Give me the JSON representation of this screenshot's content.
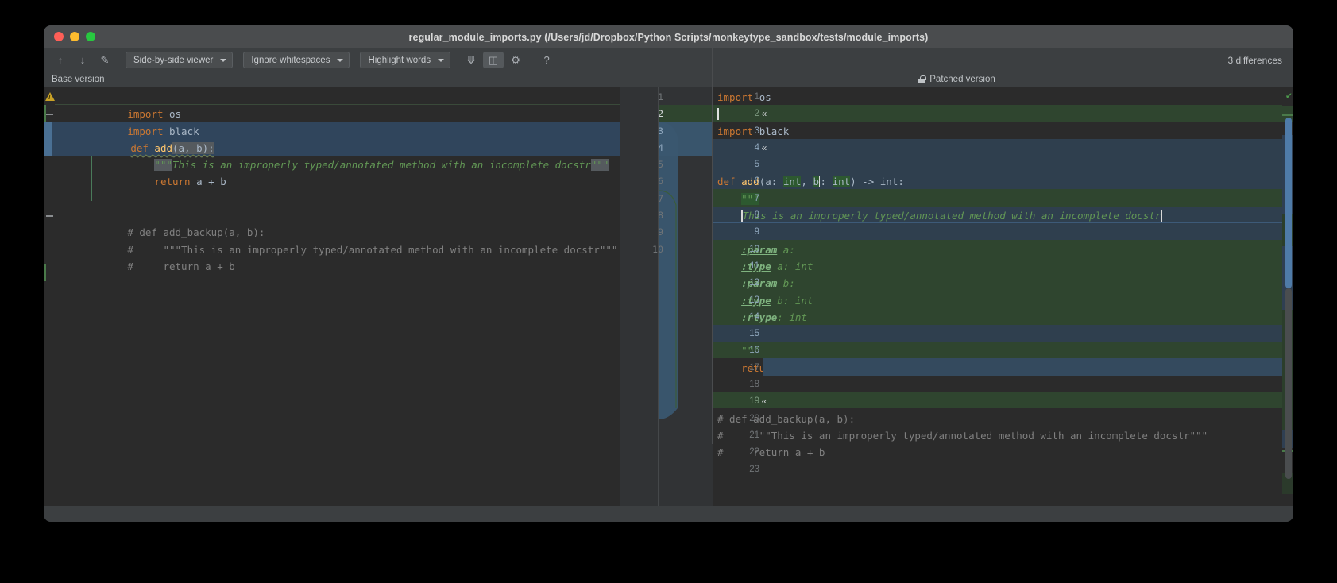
{
  "window": {
    "title": "regular_module_imports.py (/Users/jd/Dropbox/Python Scripts/monkeytype_sandbox/tests/module_imports)",
    "traffic": {
      "close": "close-window",
      "minimize": "minimize-window",
      "zoom": "zoom-window"
    }
  },
  "toolbar": {
    "prev_diff_icon": "↑",
    "next_diff_icon": "↓",
    "edit_icon": "✎",
    "viewer_mode": "Side-by-side viewer",
    "whitespace_mode": "Ignore whitespaces",
    "highlight_mode": "Highlight words",
    "collapse_icon": "⟱",
    "sync_icon": "◫",
    "settings_icon": "⚙",
    "help_icon": "?",
    "differences_label": "3 differences"
  },
  "panes": {
    "left_title": "Base version",
    "right_title": "Patched version",
    "right_locked": true
  },
  "left_lines": [
    {
      "n": 1,
      "text": "import os"
    },
    {
      "n": 2,
      "text": "import black"
    },
    {
      "n": 3,
      "text": "def add(a, b):"
    },
    {
      "n": 4,
      "text": "    \"\"\"This is an improperly typed/annotated method with an incomplete docstr\"\"\""
    },
    {
      "n": 5,
      "text": "    return a + b"
    },
    {
      "n": 6,
      "text": ""
    },
    {
      "n": 7,
      "text": ""
    },
    {
      "n": 8,
      "text": "# def add_backup(a, b):"
    },
    {
      "n": 9,
      "text": "#     \"\"\"This is an improperly typed/annotated method with an incomplete docstr\"\"\""
    },
    {
      "n": 10,
      "text": "#     return a + b"
    }
  ],
  "left_gutter_numbers": [
    "1",
    "2",
    "3",
    "4",
    "5",
    "6",
    "7",
    "8",
    "9",
    "10"
  ],
  "right_lines": [
    {
      "n": 1,
      "text": "import os"
    },
    {
      "n": 2,
      "text": ""
    },
    {
      "n": 3,
      "text": "import black"
    },
    {
      "n": 4,
      "text": ""
    },
    {
      "n": 5,
      "text": ""
    },
    {
      "n": 6,
      "text": "def add(a: int, b: int) -> int:"
    },
    {
      "n": 7,
      "text": "    \"\"\""
    },
    {
      "n": 8,
      "text": "    This is an improperly typed/annotated method with an incomplete docstr"
    },
    {
      "n": 9,
      "text": ""
    },
    {
      "n": 10,
      "text": "    :param a:"
    },
    {
      "n": 11,
      "text": "    :type a: int"
    },
    {
      "n": 12,
      "text": "    :param b:"
    },
    {
      "n": 13,
      "text": "    :type b: int"
    },
    {
      "n": 14,
      "text": "    :rtype: int"
    },
    {
      "n": 15,
      "text": ""
    },
    {
      "n": 16,
      "text": "    \"\"\""
    },
    {
      "n": 17,
      "text": "    return a + b"
    },
    {
      "n": 18,
      "text": ""
    },
    {
      "n": 19,
      "text": ""
    },
    {
      "n": 20,
      "text": "# def add_backup(a, b):"
    },
    {
      "n": 21,
      "text": "#     \"\"\"This is an improperly typed/annotated method with an incomplete docstr\"\"\""
    },
    {
      "n": 22,
      "text": "#     return a + b"
    },
    {
      "n": 23,
      "text": ""
    }
  ],
  "tokens": {
    "import": "import",
    "os": "os",
    "black": "black",
    "def": "def",
    "add": "add",
    "sig_base": "(a, b):",
    "sig_patched_open": "(",
    "a_name": "a",
    "colon_space": ": ",
    "int": "int",
    "comma": ", ",
    "b_name": "b",
    "close_arrow": ") -> ",
    "colon": ":",
    "return": "return",
    "return_expr": "a + b",
    "triple_quote": "\"\"\"",
    "docstring_body": "This is an improperly typed/annotated method with an incomplete docstr",
    "param_a": ":param",
    "type_a": ":type",
    "rtype": ":rtype",
    "arg_a": "a:",
    "arg_a_type": "a: int",
    "arg_b": "b:",
    "arg_b_type": "b: int",
    "rtype_val": ": int",
    "hash": "#",
    "comment_def": "# def add_backup(a, b):",
    "comment_doc": "#     \"\"\"This is an improperly typed/annotated method with an incomplete docstr\"\"\"",
    "comment_return": "#     return a + b"
  },
  "colors": {
    "keyword": "#cc7832",
    "function": "#ffc66d",
    "text": "#a9b7c6",
    "comment": "#808080",
    "docstring": "#629755",
    "doc_tag": "#7fb37f",
    "insert_band": "#2f452f",
    "modify_band": "#30455c",
    "editor_bg": "#2b2b2b",
    "chrome_bg": "#3c3f41",
    "titlebar_bg": "#4a4c4e"
  },
  "overview": {
    "status_icon": "✔",
    "status_label": "no-errors-check"
  }
}
